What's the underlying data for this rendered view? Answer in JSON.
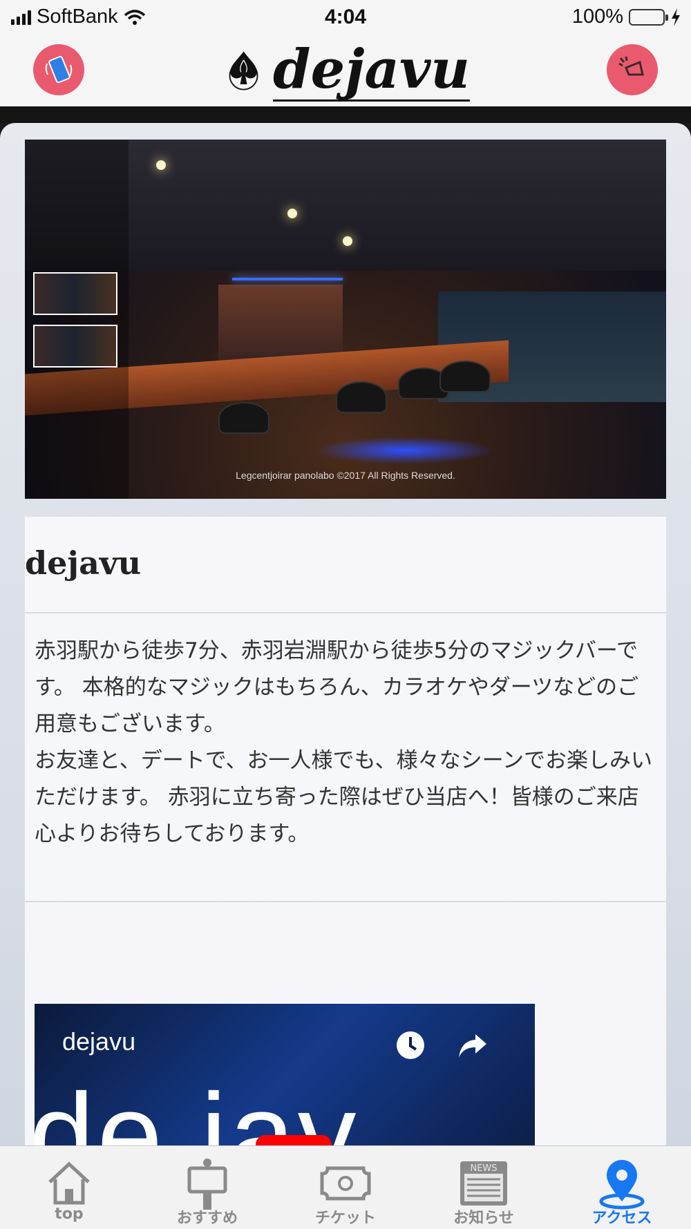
{
  "status": {
    "carrier": "SoftBank",
    "time": "4:04",
    "battery": "100%"
  },
  "header": {
    "logo_text": "dejavu"
  },
  "pano": {
    "credit": "Legcentjoirar  panolabo ©2017 All Rights Reserved."
  },
  "shop": {
    "name": "dejavu",
    "description": "赤羽駅から徒歩7分、赤羽岩淵駅から徒歩5分のマジックバーです。 本格的なマジックはもちろん、カラオケやダーツなどのご用意もございます。\nお友達と、デートで、お一人様でも、様々なシーンでお楽しみいただけます。 赤羽に立ち寄った際はぜひ当店へ！皆様のご来店心よりお待ちしております。"
  },
  "video": {
    "title": "dejavu",
    "big_text": "de jav"
  },
  "tabs": [
    {
      "label": "top",
      "icon": "home-icon"
    },
    {
      "label": "おすすめ",
      "icon": "signboard-icon"
    },
    {
      "label": "チケット",
      "icon": "ticket-icon"
    },
    {
      "label": "お知らせ",
      "icon": "news-icon"
    },
    {
      "label": "アクセス",
      "icon": "location-pin-icon",
      "active": true
    }
  ],
  "colors": {
    "accent": "#1877f2",
    "header_button": "#ea5a6e",
    "tab_inactive": "#8a8a8a"
  }
}
